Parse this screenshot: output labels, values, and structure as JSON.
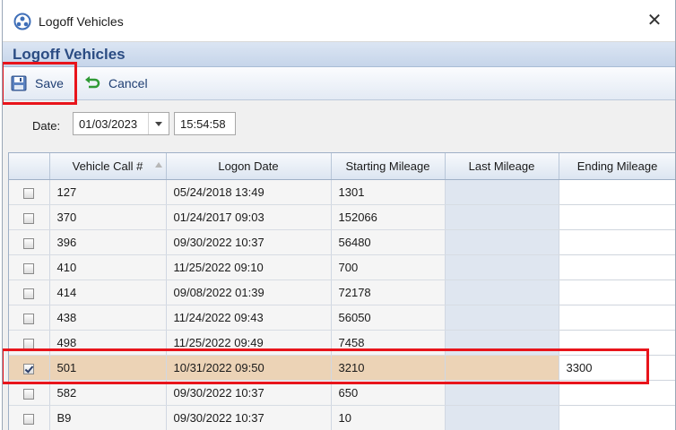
{
  "window": {
    "title": "Logoff Vehicles",
    "close_label": "✕"
  },
  "header": {
    "title": "Logoff Vehicles"
  },
  "toolbar": {
    "save_label": "Save",
    "cancel_label": "Cancel"
  },
  "datebar": {
    "date_label": "Date:",
    "date_value": "01/03/2023",
    "time_value": "15:54:58"
  },
  "grid": {
    "columns": [
      "",
      "Vehicle Call #",
      "Logon Date",
      "Starting Mileage",
      "Last Mileage",
      "Ending Mileage"
    ],
    "rows": [
      {
        "checked": false,
        "call": "127",
        "logon": "05/24/2018 13:49",
        "start": "1301",
        "last": "",
        "end": ""
      },
      {
        "checked": false,
        "call": "370",
        "logon": "01/24/2017 09:03",
        "start": "152066",
        "last": "",
        "end": ""
      },
      {
        "checked": false,
        "call": "396",
        "logon": "09/30/2022 10:37",
        "start": "56480",
        "last": "",
        "end": ""
      },
      {
        "checked": false,
        "call": "410",
        "logon": "11/25/2022 09:10",
        "start": "700",
        "last": "",
        "end": ""
      },
      {
        "checked": false,
        "call": "414",
        "logon": "09/08/2022 01:39",
        "start": "72178",
        "last": "",
        "end": ""
      },
      {
        "checked": false,
        "call": "438",
        "logon": "11/24/2022 09:43",
        "start": "56050",
        "last": "",
        "end": ""
      },
      {
        "checked": false,
        "call": "498",
        "logon": "11/25/2022 09:49",
        "start": "7458",
        "last": "",
        "end": ""
      },
      {
        "checked": true,
        "call": "501",
        "logon": "10/31/2022 09:50",
        "start": "3210",
        "last": "",
        "end": "3300"
      },
      {
        "checked": false,
        "call": "582",
        "logon": "09/30/2022 10:37",
        "start": "650",
        "last": "",
        "end": ""
      },
      {
        "checked": false,
        "call": "B9",
        "logon": "09/30/2022 10:37",
        "start": "10",
        "last": "",
        "end": ""
      }
    ]
  },
  "colors": {
    "header_text": "#2b4c83",
    "selected_row": "#ecd3b6",
    "highlight_box": "#e8141b"
  },
  "icons": {
    "app": "app-logo-icon",
    "save": "floppy-disk-icon",
    "cancel": "undo-arrow-icon",
    "close": "close-icon"
  }
}
